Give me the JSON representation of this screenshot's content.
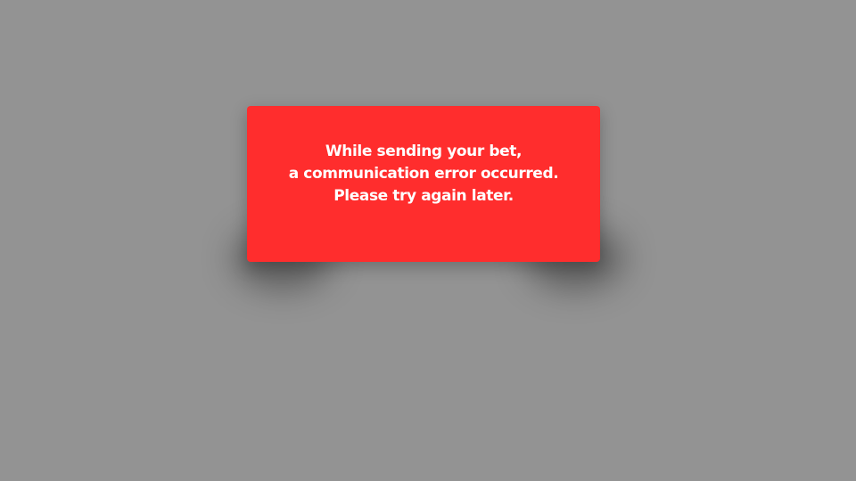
{
  "dialog": {
    "message_lines": [
      "While sending your bet,",
      "a communication error occurred.",
      "Please try again later."
    ]
  },
  "colors": {
    "backdrop": "#939393",
    "dialog_background": "#ff2d2d",
    "text": "#ffffff"
  }
}
